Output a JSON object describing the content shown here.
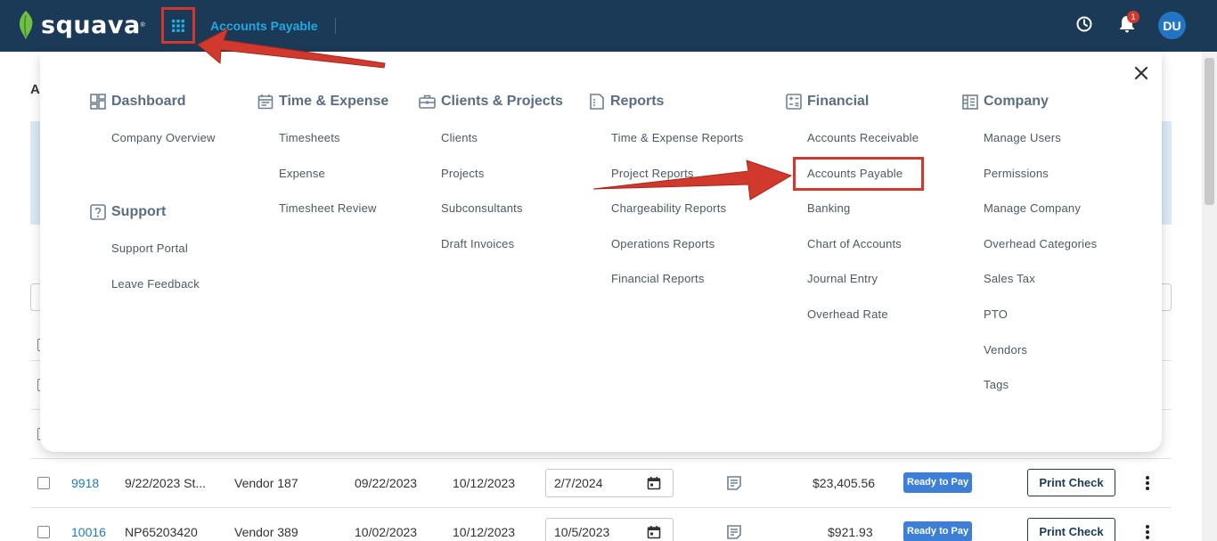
{
  "app": {
    "logo_text": "squava",
    "page_title": "Accounts Payable",
    "notification_count": "1",
    "avatar_initials": "DU",
    "background_heading_fragment": "A"
  },
  "menu": {
    "columns": [
      {
        "title": "Dashboard",
        "icon": "dashboard-icon",
        "items": [
          "Company Overview"
        ]
      },
      {
        "title": "Time & Expense",
        "icon": "calendar-icon",
        "items": [
          "Timesheets",
          "Expense",
          "Timesheet Review"
        ]
      },
      {
        "title": "Clients & Projects",
        "icon": "briefcase-icon",
        "items": [
          "Clients",
          "Projects",
          "Subconsultants",
          "Draft Invoices"
        ]
      },
      {
        "title": "Reports",
        "icon": "report-icon",
        "items": [
          "Time & Expense Reports",
          "Project Reports",
          "Chargeability Reports",
          "Operations Reports",
          "Financial Reports"
        ]
      },
      {
        "title": "Financial",
        "icon": "calculator-icon",
        "items": [
          "Accounts Receivable",
          "Accounts Payable",
          "Banking",
          "Chart of Accounts",
          "Journal Entry",
          "Overhead Rate"
        ]
      },
      {
        "title": "Company",
        "icon": "building-icon",
        "items": [
          "Manage Users",
          "Permissions",
          "Manage Company",
          "Overhead Categories",
          "Sales Tax",
          "PTO",
          "Vendors",
          "Tags"
        ]
      }
    ],
    "support": {
      "title": "Support",
      "icon": "help-icon",
      "items": [
        "Support Portal",
        "Leave Feedback"
      ]
    }
  },
  "table": {
    "rows": [
      {
        "id": "9918",
        "description": "9/22/2023 St...",
        "vendor": "Vendor 187",
        "bill_date": "09/22/2023",
        "due_date": "10/12/2023",
        "pay_date": "2/7/2024",
        "amount": "$23,405.56",
        "status": "Ready to Pay",
        "action": "Print Check"
      },
      {
        "id": "10016",
        "description": "NP65203420",
        "vendor": "Vendor 389",
        "bill_date": "10/02/2023",
        "due_date": "10/12/2023",
        "pay_date": "10/5/2023",
        "amount": "$921.93",
        "status": "Ready to Pay",
        "action": "Print Check"
      }
    ]
  },
  "colors": {
    "topbar": "#1b3a57",
    "accent": "#23a9e1",
    "highlight": "#d0392b",
    "status_badge": "#3d7fd6"
  }
}
